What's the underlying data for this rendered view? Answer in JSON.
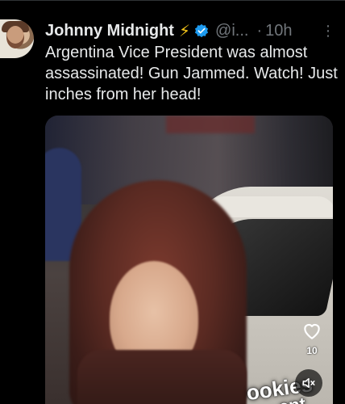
{
  "tweet": {
    "display_name": "Johnny Midnight",
    "bolt": "⚡",
    "handle": "@i...",
    "separator": "·",
    "time": "10h",
    "more": "⋮",
    "text": "Argentina Vice President was almost assassinated! Gun Jammed. Watch! Just inches from her head!"
  },
  "media": {
    "watermark_line1": "ookies",
    "watermark_line2": "ent",
    "like_count": "10",
    "heart_icon": "heart-outline-icon",
    "mute_icon": "speaker-muted-icon"
  },
  "colors": {
    "background": "#000000",
    "text": "#e7e9ea",
    "muted": "#71767b",
    "verified": "#1d9bf0",
    "bolt": "#f5c518"
  }
}
